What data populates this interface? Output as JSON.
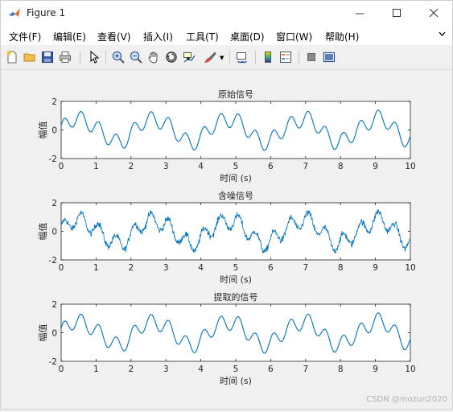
{
  "window": {
    "title": "Figure 1",
    "minimize_icon": "minimize-icon",
    "maximize_icon": "maximize-icon",
    "close_icon": "close-icon"
  },
  "menu": {
    "items": [
      {
        "label": "文件(F)"
      },
      {
        "label": "编辑(E)"
      },
      {
        "label": "查看(V)"
      },
      {
        "label": "插入(I)"
      },
      {
        "label": "工具(T)"
      },
      {
        "label": "桌面(D)"
      },
      {
        "label": "窗口(W)"
      },
      {
        "label": "帮助(H)"
      }
    ],
    "overflow_icon": "chevron-down-icon"
  },
  "toolbar": {
    "icons": [
      "new-figure-icon",
      "open-file-icon",
      "save-icon",
      "print-icon",
      "pointer-icon",
      "zoom-in-icon",
      "zoom-out-icon",
      "pan-hand-icon",
      "rotate-3d-icon",
      "data-cursor-icon",
      "brush-icon",
      "link-plot-icon",
      "colorbar-icon",
      "legend-icon",
      "hide-plot-tools-icon",
      "show-plot-tools-icon"
    ]
  },
  "chart_data": [
    {
      "type": "line",
      "title": "原始信号",
      "xlabel": "时间 (s)",
      "ylabel": "幅值",
      "xlim": [
        0,
        10
      ],
      "ylim": [
        -2,
        2
      ],
      "xticks": [
        "0",
        "1",
        "2",
        "3",
        "4",
        "5",
        "6",
        "7",
        "8",
        "9",
        "10"
      ],
      "yticks": [
        "2",
        "0",
        "-2"
      ],
      "grid": false,
      "series": [
        {
          "color": "#0072BD",
          "values_desc": "sum of 1 Hz-ish sine and harmonic",
          "a1": 1.0,
          "f1": 0.5,
          "a2": 0.5,
          "f2": 2.0
        }
      ]
    },
    {
      "type": "line",
      "title": "含噪信号",
      "xlabel": "时间 (s)",
      "ylabel": "幅值",
      "xlim": [
        0,
        10
      ],
      "ylim": [
        -2,
        2
      ],
      "xticks": [
        "0",
        "1",
        "2",
        "3",
        "4",
        "5",
        "6",
        "7",
        "8",
        "9",
        "10"
      ],
      "yticks": [
        "2",
        "0",
        "-2"
      ],
      "grid": false,
      "series": [
        {
          "color": "#0072BD",
          "noise": 0.25
        }
      ]
    },
    {
      "type": "line",
      "title": "提取的信号",
      "xlabel": "时间 (s)",
      "ylabel": "幅值",
      "xlim": [
        0,
        10
      ],
      "ylim": [
        -2,
        2
      ],
      "xticks": [
        "0",
        "1",
        "2",
        "3",
        "4",
        "5",
        "6",
        "7",
        "8",
        "9",
        "10"
      ],
      "yticks": [
        "2",
        "0",
        "-2"
      ],
      "grid": false,
      "series": [
        {
          "color": "#0072BD"
        }
      ]
    }
  ],
  "watermark": "CSDN @mozun2020"
}
